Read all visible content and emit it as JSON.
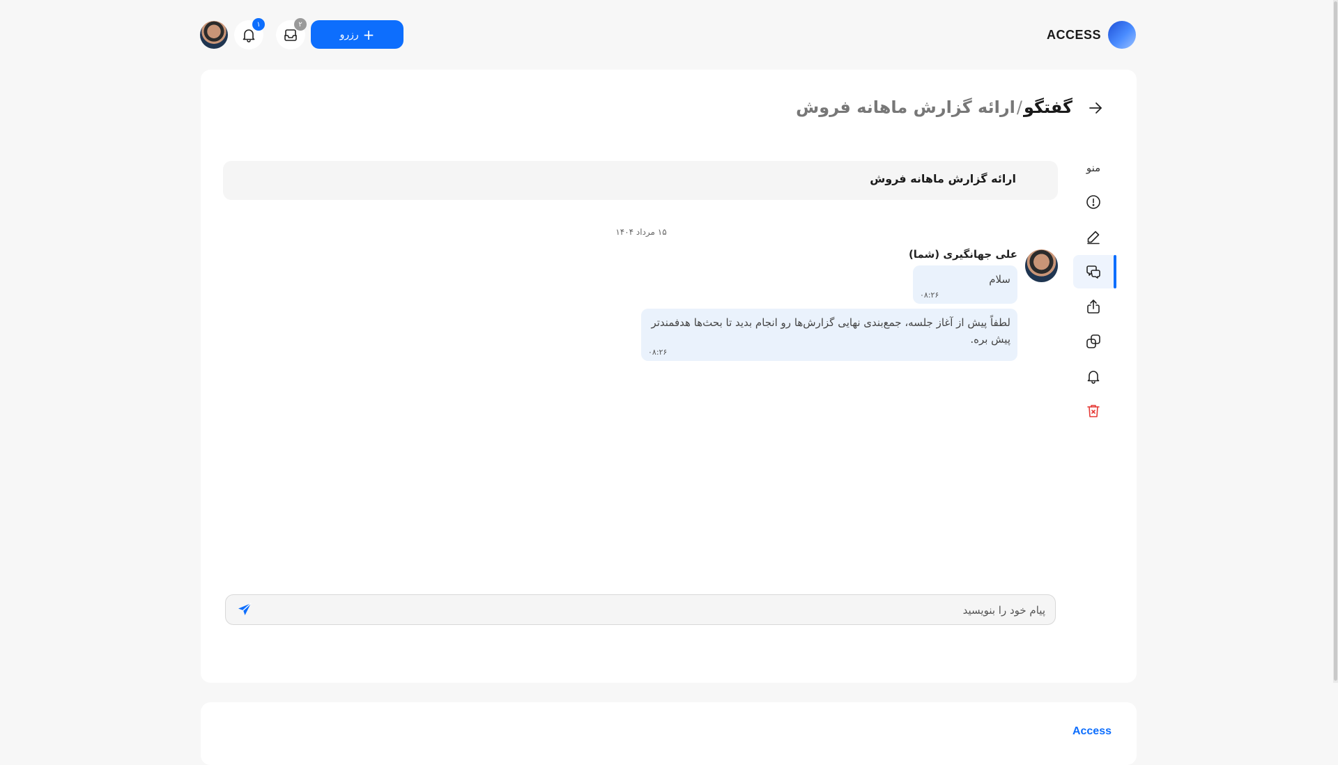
{
  "header": {
    "logo_text": "ACCESS",
    "reserve_label": "رزرو",
    "inbox_badge": "۲",
    "notif_badge": "۱"
  },
  "breadcrumb": {
    "main": "گفتگو",
    "separator": "/",
    "sub": "ارائه گزارش ماهانه فروش"
  },
  "menu": {
    "title": "منو",
    "items": [
      "info-icon",
      "edit-icon",
      "chat-icon",
      "share-icon",
      "copy-icon",
      "bell-icon",
      "trash-icon"
    ],
    "active": "chat-icon"
  },
  "conversation": {
    "title": "ارائه گزارش ماهانه فروش",
    "date": "۱۵ مرداد ۱۴۰۴",
    "sender": "علی جهانگیری (شما)",
    "messages": [
      {
        "text": "سلام",
        "time": "۰۸:۲۶"
      },
      {
        "text": "لطفاً پیش از آغاز جلسه، جمع‌بندی نهایی گزارش‌ها رو انجام بدید تا بحث‌ها هدفمندتر پیش بره.",
        "time": "۰۸:۲۶"
      }
    ]
  },
  "composer": {
    "placeholder": "پیام خود را بنویسید"
  },
  "footer": {
    "brand": "Access"
  },
  "colors": {
    "accent": "#0d6efd",
    "bubble": "#eaf2fc",
    "danger": "#e53935"
  }
}
